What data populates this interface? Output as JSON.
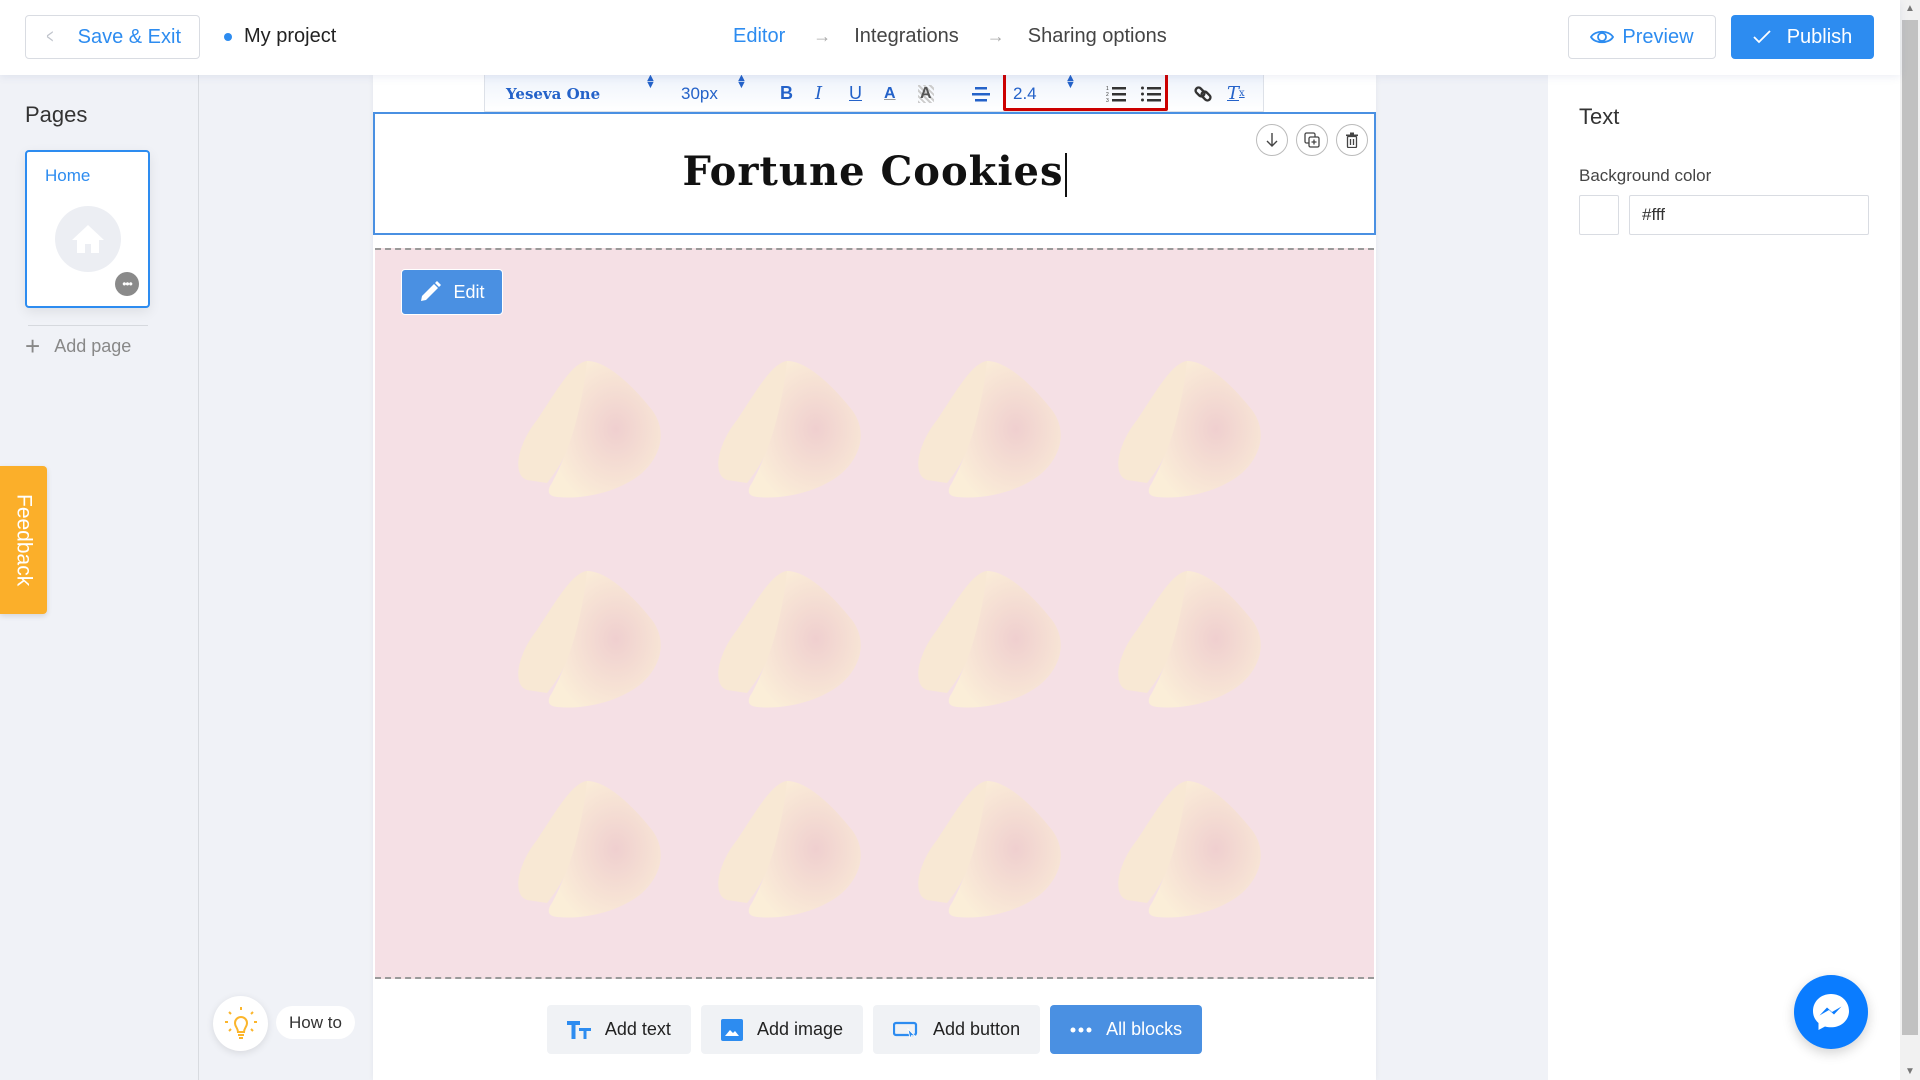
{
  "header": {
    "save_exit_label": "Save & Exit",
    "project_name": "My project",
    "steps": [
      {
        "label": "Editor",
        "active": true
      },
      {
        "label": "Integrations",
        "active": false
      },
      {
        "label": "Sharing options",
        "active": false
      }
    ],
    "preview_label": "Preview",
    "publish_label": "Publish"
  },
  "pages_panel": {
    "title": "Pages",
    "pages": [
      {
        "name": "Home",
        "icon": "home-icon",
        "selected": true
      }
    ],
    "add_page_label": "Add page"
  },
  "feedback_label": "Feedback",
  "toolbar": {
    "font_family": "Yeseva One",
    "font_size": "30px",
    "line_height": "2.4",
    "buttons": [
      "bold-icon",
      "italic-icon",
      "underline-icon",
      "text-color-icon",
      "highlight-icon",
      "align-center-icon",
      "ordered-list-icon",
      "unordered-list-icon",
      "link-icon",
      "clear-format-icon"
    ]
  },
  "text_block": {
    "content": "Fortune Cookies",
    "actions": [
      "move-down-icon",
      "duplicate-icon",
      "delete-icon"
    ]
  },
  "image_block": {
    "edit_label": "Edit",
    "background_color": "#f5e0e5",
    "cookie_count": 12
  },
  "add_blocks": [
    {
      "label": "Add text",
      "icon": "text-icon"
    },
    {
      "label": "Add image",
      "icon": "image-icon"
    },
    {
      "label": "Add button",
      "icon": "button-icon"
    },
    {
      "label": "All blocks",
      "icon": "more-icon"
    }
  ],
  "how_to_label": "How to",
  "properties_panel": {
    "title": "Text",
    "background_color_label": "Background color",
    "background_color_value": "#fff"
  },
  "colors": {
    "accent": "#2d8cf0",
    "feedback": "#fbaf2a",
    "messenger": "#0a7cff",
    "highlight": "#cc0000"
  }
}
